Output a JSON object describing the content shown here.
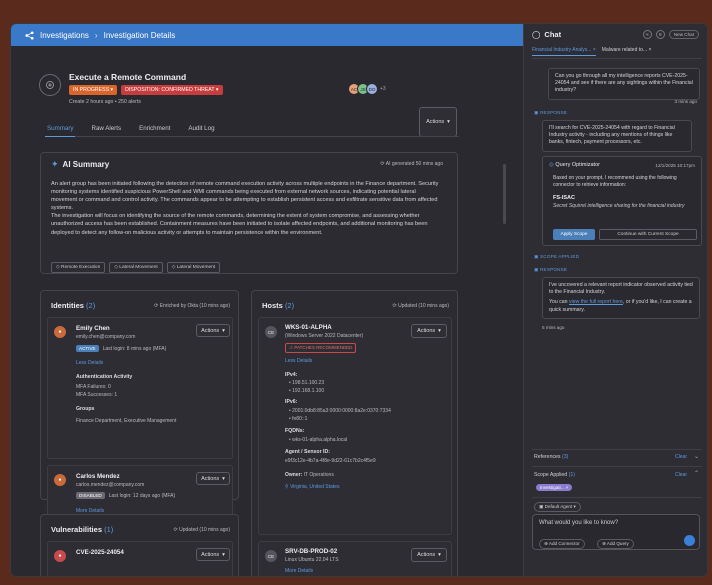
{
  "breadcrumb": {
    "root": "Investigations",
    "current": "Investigation Details"
  },
  "incident": {
    "title": "Execute a Remote Command",
    "status": "IN PROGRESS",
    "disposition": "DISPOSITION: CONFIRMED THREAT",
    "created": "Create 2 hours ago",
    "alerts": "250 alerts",
    "avatars": [
      "AC",
      "JS",
      "DO"
    ],
    "avatars_more": "+3",
    "actions_label": "Actions"
  },
  "tabs": [
    {
      "label": "Summary"
    },
    {
      "label": "Raw Alerts"
    },
    {
      "label": "Enrichment"
    },
    {
      "label": "Audit Log"
    }
  ],
  "summary": {
    "title": "AI Summary",
    "generated": "AI generated 50 mins ago",
    "p1": "An alert group has been initiated following the detection of remote command execution activity across multiple endpoints in the Finance department. Security monitoring systems identified suspicious PowerShell and WMI commands being executed from external network sources, indicating potential lateral movement or command and control activity. The commands appear to be attempting to establish persistent access and exfiltrate sensitive data from affected systems.",
    "p2": "The investigation will focus on identifying the source of the remote commands, determining the extent of system compromise, and assessing whether unauthorized access has been established. Containment measures have been initiated to isolate affected endpoints, and additional monitoring has been deployed to detect any follow-on malicious activity or attempts to maintain persistence within the environment.",
    "tags": [
      "Remote Execution",
      "Lateral Movement",
      "Lateral Movement"
    ]
  },
  "identities": {
    "title": "Identities",
    "count": "(2)",
    "enriched": "Enriched by Okta (10 mins ago)",
    "people": [
      {
        "name": "Emily Chen",
        "email": "emily.chen@company.com",
        "status": "ACTIVE",
        "last_login": "Last login: 8 mins ago (MFA)",
        "less": "Less Details",
        "auth_title": "Authentication Activity",
        "mfa_fail": "MFA Failures: 0",
        "mfa_success": "MFA Successes: 1",
        "groups_title": "Groups",
        "groups": "Finance Department, Executive Management",
        "actions": "Actions"
      },
      {
        "name": "Carlos Mendez",
        "email": "carlos.mendez@company.com",
        "status": "DISABLED",
        "last_login": "Last login: 12 days ago (MFA)",
        "more": "More Details",
        "actions": "Actions"
      }
    ]
  },
  "hosts": {
    "title": "Hosts",
    "count": "(2)",
    "updated": "Updated (10 mins ago)",
    "items": [
      {
        "name": "WKS-01-ALPHA",
        "os": "Windows Server 2022 Datacenter",
        "warning": "PATCHES RECOMMENDED",
        "less": "Less Details",
        "ipv4_label": "IPv4:",
        "ipv4": [
          "198.51.100.23",
          "192.168.1.100"
        ],
        "ipv6_label": "IPv6:",
        "ipv6": [
          "2001:0db8:85a3:0000:0000:8a2e:0370:7334",
          "fe80::1"
        ],
        "fqdn_label": "FQDNs:",
        "fqdn": [
          "wks-01-alpha.alpha.local"
        ],
        "agent_label": "Agent / Sensor ID:",
        "agent": "e9f3c12e-4b7a-4f8e-9d22-61c7b2c4f5e9",
        "owner_label": "Owner:",
        "owner": "IT Operations",
        "location": "Virginia, United States",
        "actions": "Actions"
      },
      {
        "name": "SRV-DB-PROD-02",
        "os": "Linux Ubuntu 22.04 LTS",
        "more": "More Details",
        "actions": "Actions"
      }
    ]
  },
  "vulns": {
    "title": "Vulnerabilities",
    "count": "(1)",
    "updated": "Updated (10 mins ago)",
    "first": "CVE-2025-24054",
    "actions": "Actions"
  },
  "chat": {
    "title": "Chat",
    "new_chat": "New Chat",
    "tabs": [
      "Financial Industry Analys...",
      "Malware related to..."
    ],
    "close": "×",
    "user_q": "Can you go through all my intelligence reports CVE-2025-24054 and see if there are any sightings within the Financial industry?",
    "q_time": "3 mins ago",
    "response_label": "RESPONSE",
    "resp1": "I'll search for CVE-2025-24054 with regard to Financial Industry activity - including any mentions of things like banks, fintech, payment processors, etc.",
    "opt_title": "Query Optimizator",
    "opt_date": "12/1/2025 10:17pm",
    "opt_text": "Based on your prompt, I recommend using the following connector to retrieve information:",
    "opt_src": "FS-ISAC",
    "opt_desc": "Secret Squirrel intelligence sharing for the financial industry",
    "apply": "Apply Scope",
    "continue": "Continue with Current Scope",
    "scope_applied_label": "SCOPE APPLIED",
    "response2_label": "RESPONSE",
    "resp2": "I've uncovered a relevant report indicator observed activity tied to the Financial Industry.",
    "resp2b_pre": "You can ",
    "resp2b_link": "view the full report here",
    "resp2b_post": ", or if you'd like, I can create a quick summary.",
    "resp2_time": "5 mins ago",
    "references": "References",
    "references_count": "(3)",
    "clear": "Clear",
    "scope_applied": "Scope Applied",
    "scope_count": "(1)",
    "scope_chip": "Investigati...",
    "agent": "Default Agent",
    "input_placeholder": "What would you like to know?",
    "add_connector": "Add Connector",
    "add_query": "Add Query"
  }
}
